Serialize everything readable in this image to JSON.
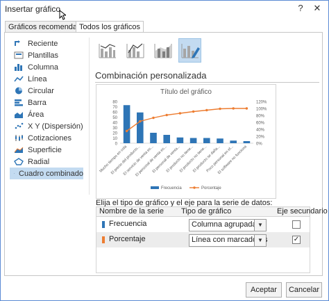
{
  "window": {
    "title": "Insertar gráfico",
    "help_glyph": "?",
    "close_glyph": "✕"
  },
  "tabs": [
    {
      "label": "Gráficos recomendados",
      "active": false
    },
    {
      "label": "Todos los gráficos",
      "active": true
    }
  ],
  "sidebar": {
    "items": [
      {
        "label": "Reciente",
        "icon": "recent-icon"
      },
      {
        "label": "Plantillas",
        "icon": "templates-icon"
      },
      {
        "label": "Columna",
        "icon": "column-chart-icon"
      },
      {
        "label": "Línea",
        "icon": "line-chart-icon"
      },
      {
        "label": "Circular",
        "icon": "pie-chart-icon"
      },
      {
        "label": "Barra",
        "icon": "bar-chart-icon"
      },
      {
        "label": "Área",
        "icon": "area-chart-icon"
      },
      {
        "label": "X Y (Dispersión)",
        "icon": "scatter-chart-icon"
      },
      {
        "label": "Cotizaciones",
        "icon": "stock-chart-icon"
      },
      {
        "label": "Superficie",
        "icon": "surface-chart-icon"
      },
      {
        "label": "Radial",
        "icon": "radar-chart-icon"
      },
      {
        "label": "Cuadro combinado",
        "icon": "combo-chart-icon",
        "selected": true
      }
    ]
  },
  "subtypes": [
    {
      "icon": "combo-clustered-column-line-icon"
    },
    {
      "icon": "combo-column-line-secondary-axis-icon"
    },
    {
      "icon": "combo-stacked-area-column-icon"
    },
    {
      "icon": "combo-custom-icon",
      "selected": true
    }
  ],
  "section_title": "Combinación personalizada",
  "chart_data": {
    "type": "bar",
    "title": "Título del gráfico",
    "categories": [
      "Mucho tiempo en cola",
      "El precio del producto...",
      "El servicio de venta es...",
      "El personal de venta es...",
      "El personal de venta...",
      "El producto no tiene...",
      "El producto no tiene...",
      "El producto se daña...",
      "Poco personal en el...",
      "El software no funciona"
    ],
    "series": [
      {
        "name": "Frecuencia",
        "type": "bar",
        "axis": "primary",
        "color": "#2e75b6",
        "values": [
          73,
          59,
          20,
          16,
          11,
          10,
          10,
          9,
          5,
          4
        ]
      },
      {
        "name": "Porcentaje",
        "type": "line",
        "axis": "secondary",
        "color": "#ed7d31",
        "values": [
          0.35,
          0.63,
          0.73,
          0.81,
          0.86,
          0.91,
          0.95,
          0.99,
          1.0,
          1.0
        ]
      }
    ],
    "y_ticks": [
      "0",
      "10",
      "20",
      "30",
      "40",
      "50",
      "60",
      "70",
      "80"
    ],
    "y2_ticks": [
      "0%",
      "20%",
      "40%",
      "60%",
      "80%",
      "100%",
      "120%"
    ],
    "ylim": [
      0,
      80
    ],
    "y2lim": [
      0,
      1.2
    ],
    "legend": "bottom",
    "grid": false
  },
  "instruction": "Elija el tipo de gráfico y el eje para la serie de datos:",
  "series_table": {
    "headers": {
      "name": "Nombre de la serie",
      "type": "Tipo de gráfico",
      "secondary": "Eje secundario"
    },
    "rows": [
      {
        "name": "Frecuencia",
        "color": "#2e75b6",
        "chart_type": "Columna agrupada",
        "secondary": false,
        "check_mark": ""
      },
      {
        "name": "Porcentaje",
        "color": "#ed7d31",
        "chart_type": "Línea con marcadores",
        "secondary": true,
        "check_mark": "✓"
      }
    ]
  },
  "buttons": {
    "accept": "Aceptar",
    "cancel": "Cancelar"
  }
}
